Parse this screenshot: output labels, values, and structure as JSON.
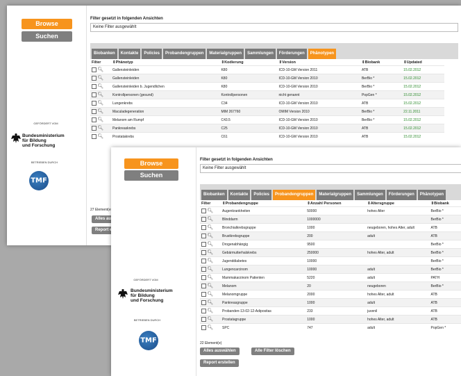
{
  "back_window": {
    "nav": {
      "browse_label": "Browse",
      "search_label": "Suchen"
    },
    "sponsor": {
      "funded_by": "GEFÖRDERT VOM",
      "ministry": "Bundesministerium\nfür Bildung\nund Forschung",
      "operated_by": "BETRIEBEN DURCH",
      "logo_text": "TMF"
    },
    "filter_title": "Filter gesetzt in folgenden Ansichten",
    "filter_value": "Keine Filter ausgewählt",
    "tabs": [
      "Biobanken",
      "Kontakte",
      "Policies",
      "Probandengruppen",
      "Materialgruppen",
      "Sammlungen",
      "Förderungen",
      "Phänotypen"
    ],
    "active_tab": "Phänotypen",
    "columns": [
      "Filter",
      "Phänotyp",
      "Kodierung",
      "Version",
      "Biobank",
      "Updated"
    ],
    "rows": [
      [
        "Gallensteinleiden",
        "K80",
        "ICD-10-GM Version 2011",
        "ATB",
        "15.02.2012"
      ],
      [
        "Gallensteinleiden",
        "K80",
        "ICD-10-GM Version 2010",
        "BerBio *",
        "15.02.2012"
      ],
      [
        "Gallensteinleiden b. Jugendlichen",
        "K80",
        "ICD-10-GM Version 2010",
        "BerBio *",
        "15.02.2012"
      ],
      [
        "Kontrollpersonen (gesund)",
        "Kontrollpersonen",
        "nicht genannt",
        "PopGen *",
        "15.02.2012"
      ],
      [
        "Lungenkrebs",
        "C34",
        "ICD-10-GM Version 2010",
        "ATB",
        "15.02.2012"
      ],
      [
        "Maculadegeneration",
        "MIM 267760",
        "OMIM Version 2010",
        "BerBio *",
        "22.11.2011"
      ],
      [
        "Melanom am Rumpf",
        "C43.5",
        "ICD-10-GM Version 2010",
        "BerBio *",
        "15.02.2012"
      ],
      [
        "Pankreaskrebs",
        "C25",
        "ICD-10-GM Version 2010",
        "ATB",
        "15.02.2012"
      ],
      [
        "Prostatakrebs",
        "C61",
        "ICD-10-GM Version 2010",
        "ATB",
        "15.02.2012"
      ]
    ],
    "count": "27 Element(e)",
    "select_all": "Alles ausw",
    "report": "Report erst"
  },
  "front_window": {
    "nav": {
      "browse_label": "Browse",
      "search_label": "Suchen"
    },
    "sponsor": {
      "funded_by": "GEFÖRDERT VOM",
      "ministry": "Bundesministerium\nfür Bildung\nund Forschung",
      "operated_by": "BETRIEBEN DURCH",
      "logo_text": "TMF"
    },
    "filter_title": "Filter gesetzt in folgenden Ansichten",
    "filter_value": "Keine Filter ausgewählt",
    "tabs": [
      "Biobanken",
      "Kontakte",
      "Policies",
      "Probandengruppen",
      "Materialgruppen",
      "Sammlungen",
      "Förderungen",
      "Phänotypen"
    ],
    "active_tab": "Probandengruppen",
    "columns": [
      "Filter",
      "Probandengruppe",
      "Anzahl Personen",
      "Altersgruppe",
      "Biobank"
    ],
    "rows": [
      [
        "Augenkrankheiten",
        "50000",
        "hohes Alter",
        "BerBio *"
      ],
      [
        "Blinddarm",
        "1000000",
        "",
        "BerBio *"
      ],
      [
        "Bronchialkrebsgruppe",
        "1000",
        "neugeboren, hohes Alter, adult",
        "ATB"
      ],
      [
        "Brustkrebsgruppe",
        "200",
        "adult",
        "ATB"
      ],
      [
        "Drogenabhängig",
        "9500",
        "",
        "BerBio *"
      ],
      [
        "Gebärmutterhalskrebs",
        "250000",
        "hohes Alter, adult",
        "BerBio *"
      ],
      [
        "Jugenddiabetes",
        "10000",
        "",
        "BerBio *"
      ],
      [
        "Lungencarcinom",
        "10000",
        "adult",
        "BerBio *"
      ],
      [
        "Mammakarzinom Patienten",
        "5220",
        "adult",
        "PATH"
      ],
      [
        "Melanom",
        "20",
        "neugeboren",
        "BerBio *"
      ],
      [
        "Melanomgruppe",
        "2000",
        "hohes Alter, adult",
        "ATB"
      ],
      [
        "Pankreasgruppe",
        "1000",
        "adult",
        "ATB"
      ],
      [
        "Probanden-13-02-12-Adipositas",
        "233",
        "juvenil",
        "ATB"
      ],
      [
        "Prostatagruppe",
        "1000",
        "hohes Alter, adult",
        "ATB"
      ],
      [
        "SPC",
        "747",
        "adult",
        "PopGen *"
      ]
    ],
    "count": "22 Element(e)",
    "select_all": "Alles auswählen",
    "clear_filters": "Alle Filter löschen",
    "report": "Report erstellen"
  }
}
